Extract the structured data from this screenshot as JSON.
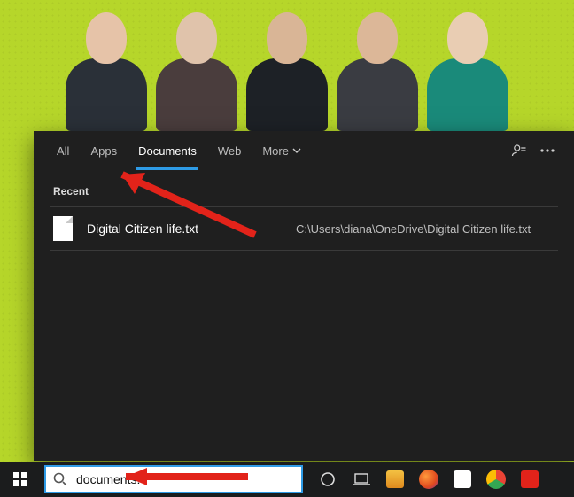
{
  "tabs": {
    "all": "All",
    "apps": "Apps",
    "documents": "Documents",
    "web": "Web",
    "more": "More",
    "active": "documents"
  },
  "section": {
    "recent": "Recent"
  },
  "result": {
    "name": "Digital Citizen life.txt",
    "path": "C:\\Users\\diana\\OneDrive\\Digital Citizen life.txt"
  },
  "search": {
    "value": "documents: "
  },
  "icons": {
    "feedback": "feedback-icon",
    "ellipsis": "ellipsis-icon",
    "chevron": "chevron-down-icon",
    "search": "search-icon",
    "start": "start-icon",
    "cortana": "cortana-icon",
    "taskview": "task-view-icon"
  },
  "colors": {
    "accent": "#2e9be6",
    "arrow": "#e2231a"
  }
}
